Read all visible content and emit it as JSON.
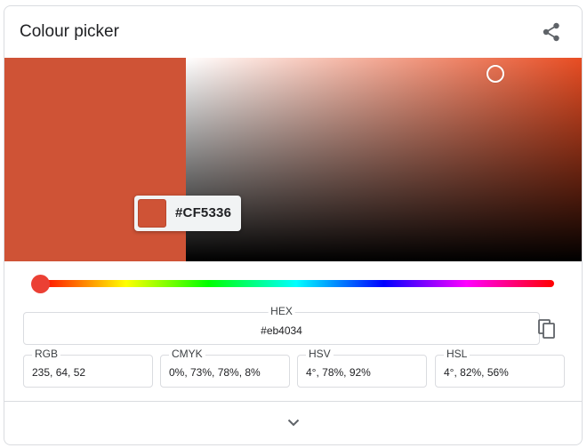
{
  "header": {
    "title": "Colour picker",
    "share_icon": "share-icon"
  },
  "picker": {
    "selected_color": "#CF5336",
    "preview_color": "#cf5336",
    "hue_color": "#eb4034",
    "tooltip_hex": "#CF5336"
  },
  "fields": {
    "hex": {
      "label": "HEX",
      "value": "#eb4034",
      "copy_icon": "copy-icon"
    },
    "rgb": {
      "label": "RGB",
      "value": "235, 64, 52"
    },
    "cmyk": {
      "label": "CMYK",
      "value": "0%, 73%, 78%, 8%"
    },
    "hsv": {
      "label": "HSV",
      "value": "4°, 78%, 92%"
    },
    "hsl": {
      "label": "HSL",
      "value": "4°, 82%, 56%"
    }
  },
  "footer": {
    "expand_icon": "chevron-down-icon"
  }
}
